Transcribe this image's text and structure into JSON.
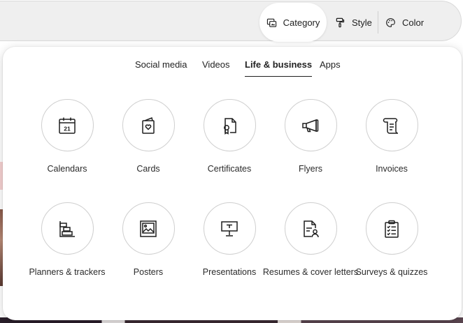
{
  "toolbar": {
    "category": {
      "label": "Category",
      "icon": "category-icon"
    },
    "style": {
      "label": "Style",
      "icon": "paint-roller-icon"
    },
    "color": {
      "label": "Color",
      "icon": "palette-icon"
    }
  },
  "tabs": [
    {
      "label": "Social media",
      "active": false
    },
    {
      "label": "Videos",
      "active": false
    },
    {
      "label": "Life & business",
      "active": true
    },
    {
      "label": "Apps",
      "active": false
    }
  ],
  "categories": [
    {
      "label": "Calendars",
      "icon": "calendar-icon",
      "icon_text": "21"
    },
    {
      "label": "Cards",
      "icon": "card-icon"
    },
    {
      "label": "Certificates",
      "icon": "certificate-icon"
    },
    {
      "label": "Flyers",
      "icon": "megaphone-icon"
    },
    {
      "label": "Invoices",
      "icon": "receipt-icon"
    },
    {
      "label": "Planners & trackers",
      "icon": "planner-icon"
    },
    {
      "label": "Posters",
      "icon": "poster-icon"
    },
    {
      "label": "Presentations",
      "icon": "presentation-icon"
    },
    {
      "label": "Resumes & cover letters",
      "icon": "resume-icon"
    },
    {
      "label": "Surveys & quizzes",
      "icon": "clipboard-icon"
    }
  ],
  "colors": {
    "text": "#1e1e1e",
    "border": "#cfcfcf",
    "toolbar_bg": "#efefef"
  }
}
